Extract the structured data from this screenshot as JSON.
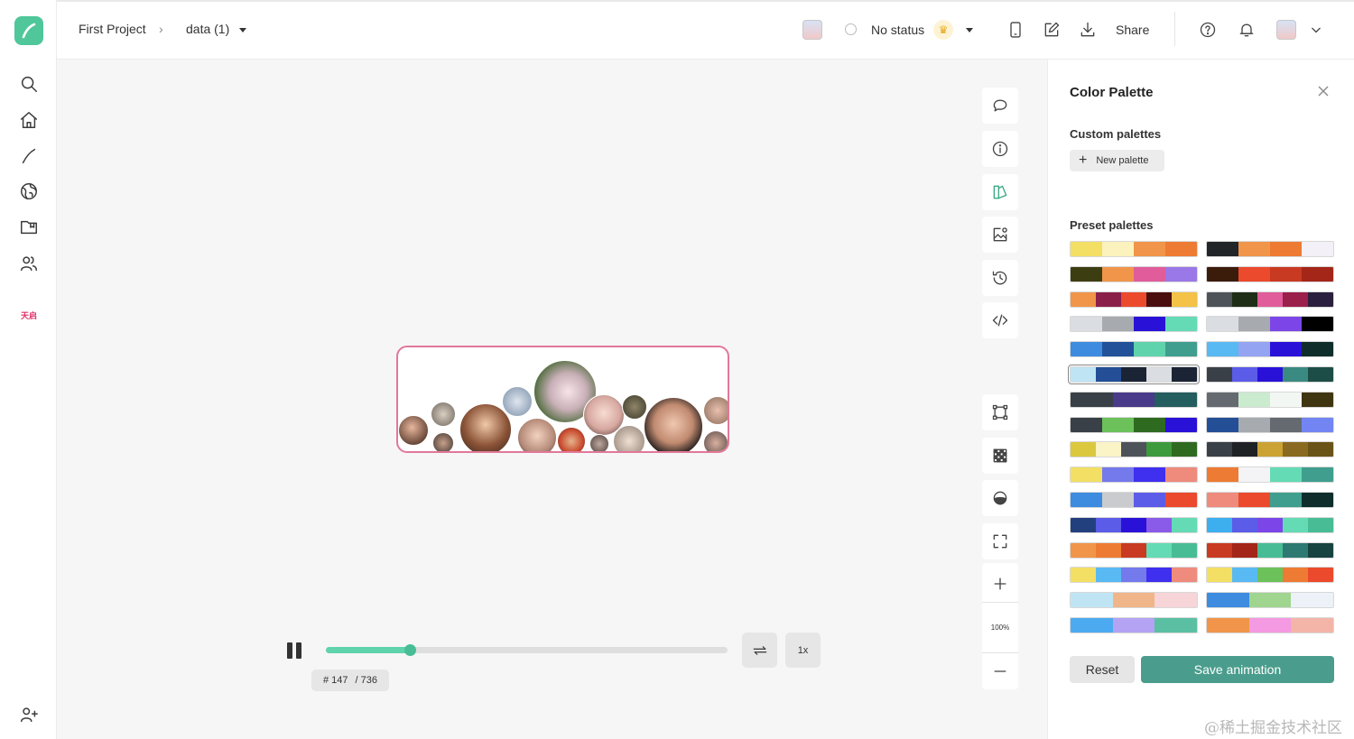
{
  "breadcrumb": {
    "project": "First Project",
    "file": "data (1)"
  },
  "status": {
    "label": "No status"
  },
  "header": {
    "share_label": "Share"
  },
  "rail": {
    "brand_text": "天启"
  },
  "player": {
    "current_frame": "# 147",
    "total_frames": "/ 736",
    "speed_label": "1x",
    "progress": 0.21
  },
  "zoom": {
    "level": "100%"
  },
  "panel": {
    "title": "Color Palette",
    "custom_label": "Custom palettes",
    "new_palette_label": "New palette",
    "preset_label": "Preset palettes",
    "reset_label": "Reset",
    "save_label": "Save animation"
  },
  "palettes": [
    [
      "#f3df63",
      "#fcf2bd",
      "#f0954a",
      "#ee7b33"
    ],
    [
      "#232629",
      "#f0954a",
      "#ee7b33",
      "#f4f0f7"
    ],
    [
      "#3d3d12",
      "#f0954a",
      "#e05c9a",
      "#9a78e8"
    ],
    [
      "#3b1c0b",
      "#eb4a2c",
      "#c93a22",
      "#a32618"
    ],
    [
      "#f0954a",
      "#8a1f4a",
      "#eb4a2c",
      "#4a0e0e",
      "#f3c246"
    ],
    [
      "#4e535a",
      "#1f2e16",
      "#e05c9a",
      "#9a1f4a",
      "#2b1f3f"
    ],
    [
      "#dadde2",
      "#a7abb0",
      "#2a11d8",
      "#64dbb4"
    ],
    [
      "#dadde2",
      "#a7abb0",
      "#7b45e8",
      "#000000"
    ],
    [
      "#3d8ce0",
      "#22519a",
      "#5fd3ac",
      "#409e8e"
    ],
    [
      "#59b9f2",
      "#94a3f2",
      "#2a11d8",
      "#0f2e2b"
    ],
    [
      "#bfe5f5",
      "#244f96",
      "#1b2434",
      "#dadde2",
      "#1b2434"
    ],
    [
      "#3a4047",
      "#5b5ce8",
      "#2a11d8",
      "#3b8a82",
      "#1d4d47"
    ],
    [
      "#3a4047",
      "#493a8a",
      "#255e5e"
    ],
    [
      "#656a70",
      "#cbebcf",
      "#f2f7f3",
      "#3f3511"
    ],
    [
      "#3a4047",
      "#6cc15b",
      "#2f6a21",
      "#2a11d8"
    ],
    [
      "#244f96",
      "#a7abb0",
      "#656a70",
      "#7385f2"
    ],
    [
      "#dbc83f",
      "#fbf4c6",
      "#4e535a",
      "#3d9a3d",
      "#2f6a21"
    ],
    [
      "#3a4047",
      "#1f2225",
      "#cba234",
      "#8a6a20",
      "#6a5316"
    ],
    [
      "#f3df63",
      "#7479ec",
      "#3f2fef",
      "#ee8b7d"
    ],
    [
      "#ee7b33",
      "#f4f4f7",
      "#64dbb4",
      "#409e8e"
    ],
    [
      "#3d8ce0",
      "#c9cbcf",
      "#5b5ce8",
      "#eb4a2c"
    ],
    [
      "#ee8b7d",
      "#eb4a2c",
      "#409e8e",
      "#0f2e2b"
    ],
    [
      "#22407e",
      "#5b5ce8",
      "#2a11d8",
      "#8a5ae8",
      "#64dbb4"
    ],
    [
      "#3dafef",
      "#5b5ce8",
      "#7b45e8",
      "#64dbb4",
      "#48bd95"
    ],
    [
      "#f0954a",
      "#ee7b33",
      "#c93a22",
      "#64dbb4",
      "#48bd95"
    ],
    [
      "#c93a22",
      "#a32618",
      "#48bd95",
      "#2e7a72",
      "#174340"
    ],
    [
      "#f3df63",
      "#59b9f2",
      "#7479ec",
      "#3f2fef",
      "#ee8b7d"
    ],
    [
      "#f3df63",
      "#59b9f2",
      "#6cc15b",
      "#ee7b33",
      "#eb4a2c"
    ],
    [
      "#bfe5f5",
      "#f0b589",
      "#f7d4d7"
    ],
    [
      "#3d8ce0",
      "#9fd58f",
      "#edf2f8"
    ],
    [
      "#4caaf0",
      "#b4a3f2",
      "#5bc0a3"
    ],
    [
      "#f0954a",
      "#f39ae2",
      "#f3b5a8"
    ]
  ]
}
